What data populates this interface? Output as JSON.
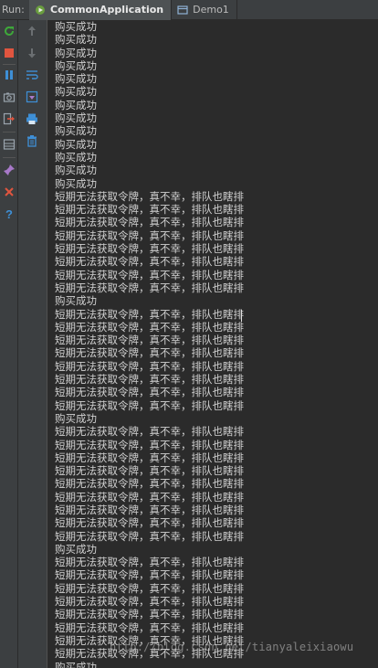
{
  "run_tool": {
    "label": "Run:",
    "tabs": [
      {
        "label": "CommonApplication",
        "icon": "android-run-icon",
        "active": true
      },
      {
        "label": "Demo1",
        "icon": "window-icon",
        "active": false
      }
    ]
  },
  "colors": {
    "background": "#2b2b2b",
    "toolbar": "#3c3f41",
    "text": "#d0d0d0",
    "rerun": "#3ea83a",
    "stop": "#e0553f",
    "pause": "#3e8fd6"
  },
  "toolbar_left": [
    "rerun-icon",
    "stop-icon",
    "pause-icon",
    "camera-dump-icon",
    "exit-icon",
    "layout-icon",
    "pin-icon",
    "close-icon",
    "help-icon"
  ],
  "toolbar_right": [
    "up-arrow-icon",
    "down-arrow-icon",
    "soft-wrap-icon",
    "scroll-to-end-icon",
    "print-icon",
    "trash-icon"
  ],
  "console": {
    "lines": [
      "购买成功",
      "购买成功",
      "购买成功",
      "购买成功",
      "购买成功",
      "购买成功",
      "购买成功",
      "购买成功",
      "购买成功",
      "购买成功",
      "购买成功",
      "购买成功",
      "购买成功",
      "短期无法获取令牌，真不幸，排队也瞎排",
      "短期无法获取令牌，真不幸，排队也瞎排",
      "短期无法获取令牌，真不幸，排队也瞎排",
      "短期无法获取令牌，真不幸，排队也瞎排",
      "短期无法获取令牌，真不幸，排队也瞎排",
      "短期无法获取令牌，真不幸，排队也瞎排",
      "短期无法获取令牌，真不幸，排队也瞎排",
      "短期无法获取令牌，真不幸，排队也瞎排",
      "购买成功",
      "短期无法获取令牌，真不幸，排队也瞎排",
      "短期无法获取令牌，真不幸，排队也瞎排",
      "短期无法获取令牌，真不幸，排队也瞎排",
      "短期无法获取令牌，真不幸，排队也瞎排",
      "短期无法获取令牌，真不幸，排队也瞎排",
      "短期无法获取令牌，真不幸，排队也瞎排",
      "短期无法获取令牌，真不幸，排队也瞎排",
      "短期无法获取令牌，真不幸，排队也瞎排",
      "购买成功",
      "短期无法获取令牌，真不幸，排队也瞎排",
      "短期无法获取令牌，真不幸，排队也瞎排",
      "短期无法获取令牌，真不幸，排队也瞎排",
      "短期无法获取令牌，真不幸，排队也瞎排",
      "短期无法获取令牌，真不幸，排队也瞎排",
      "短期无法获取令牌，真不幸，排队也瞎排",
      "短期无法获取令牌，真不幸，排队也瞎排",
      "短期无法获取令牌，真不幸，排队也瞎排",
      "短期无法获取令牌，真不幸，排队也瞎排",
      "购买成功",
      "短期无法获取令牌，真不幸，排队也瞎排",
      "短期无法获取令牌，真不幸，排队也瞎排",
      "短期无法获取令牌，真不幸，排队也瞎排",
      "短期无法获取令牌，真不幸，排队也瞎排",
      "短期无法获取令牌，真不幸，排队也瞎排",
      "短期无法获取令牌，真不幸，排队也瞎排",
      "短期无法获取令牌，真不幸，排队也瞎排",
      "短期无法获取令牌，真不幸，排队也瞎排",
      "购买成功"
    ]
  },
  "watermark": "http://blog.csdn.net/tianyaleixiaowu"
}
